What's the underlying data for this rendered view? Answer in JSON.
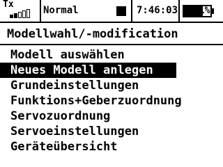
{
  "status_bar": {
    "tx_label": "Tx",
    "signal_icon": "signal-strength-icon",
    "signal_level": 0.4,
    "mode": "Normal",
    "mode_icon": "filled-square-icon",
    "clock": "7:46:03",
    "battery_icon": "battery-icon",
    "battery_percent": "71%",
    "battery_level": 0.71
  },
  "screen": {
    "title": "Modellwahl/-modification"
  },
  "menu": {
    "selected_index": 1,
    "items": [
      {
        "label": "Modell auswählen"
      },
      {
        "label": "Neues Modell anlegen"
      },
      {
        "label": "Grundeinstellungen"
      },
      {
        "label": "Funktions+Geberzuordnung"
      },
      {
        "label": "Servozuordnung"
      },
      {
        "label": "Servoeinstellungen"
      },
      {
        "label": "Geräteübersicht"
      }
    ]
  },
  "colors": {
    "background": "#ffffff",
    "foreground": "#000000"
  }
}
